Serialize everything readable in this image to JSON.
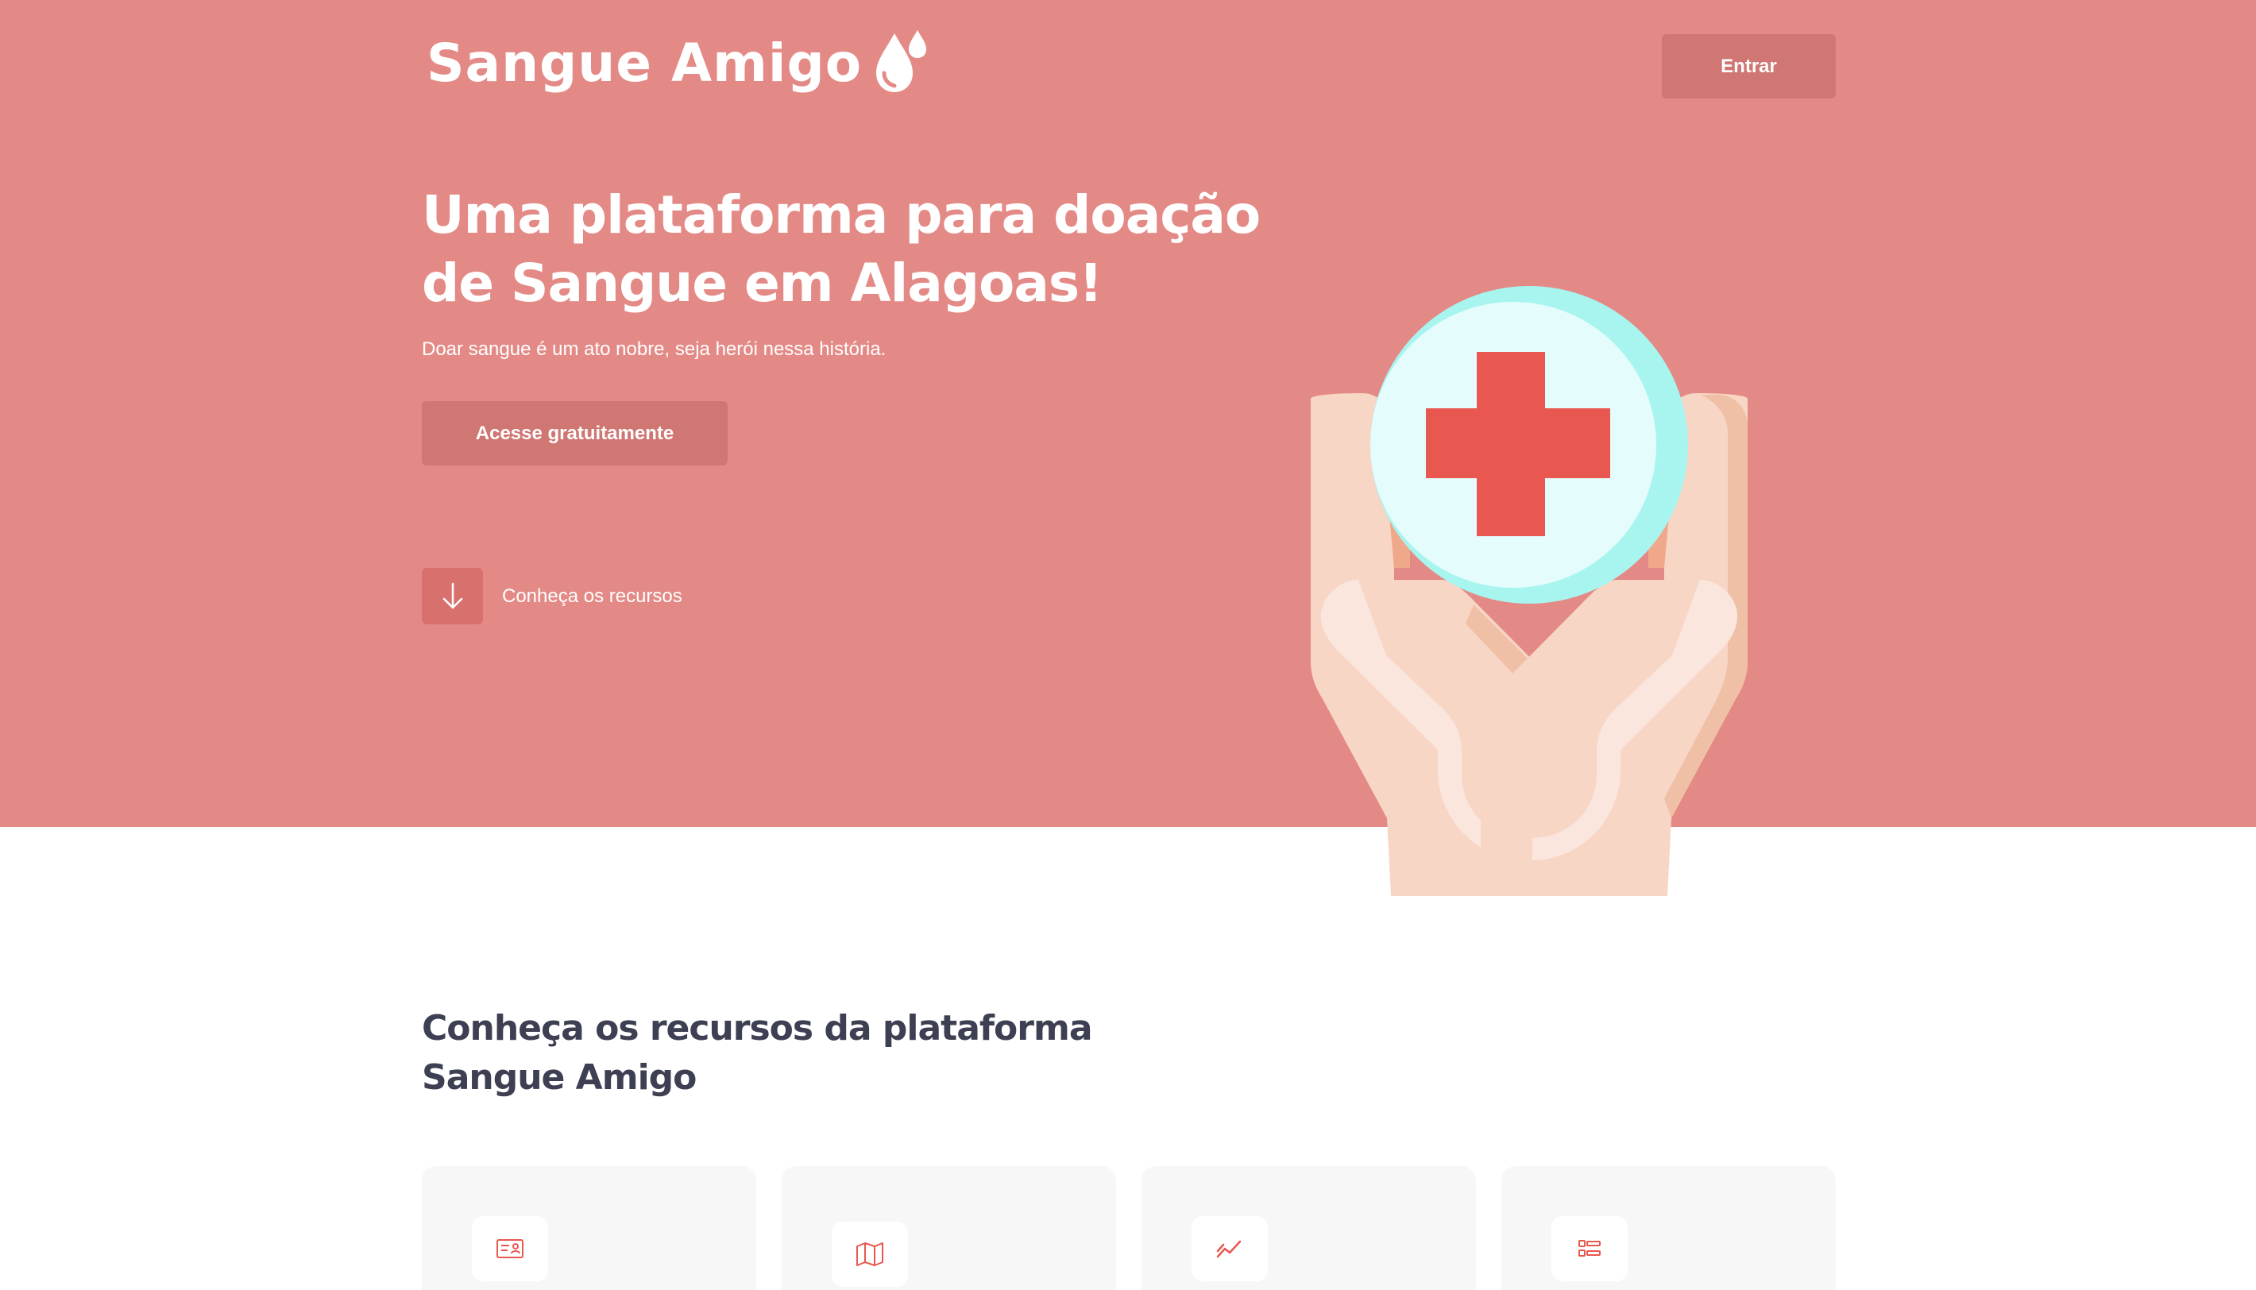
{
  "brand": {
    "name": "Sangue Amigo",
    "logo_icon": "blood-drops-icon",
    "primary_color": "#e48a86",
    "button_color": "#d07773",
    "accent_red": "#e85850"
  },
  "header": {
    "login_label": "Entrar"
  },
  "hero": {
    "title": "Uma plataforma para doação de Sangue em Alagoas!",
    "subtitle": "Doar sangue é um ato nobre, seja herói nessa história.",
    "cta_label": "Acesse gratuitamente",
    "scroll_label": "Conheça os recursos",
    "scroll_icon": "arrow-down-icon",
    "illustration": "hands-holding-medical-cross-icon"
  },
  "features": {
    "title": "Conheça os recursos da plataforma Sangue Amigo",
    "cards": [
      {
        "icon": "id-card-icon"
      },
      {
        "icon": "map-icon"
      },
      {
        "icon": "trending-up-chart-icon"
      },
      {
        "icon": "list-icon"
      }
    ]
  }
}
